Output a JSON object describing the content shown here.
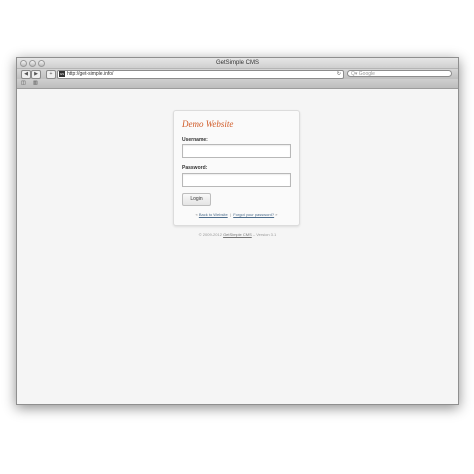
{
  "window": {
    "title": "GetSimple CMS"
  },
  "toolbar": {
    "back": "◀",
    "forward": "▶",
    "add": "+",
    "favicon": "GS",
    "url": "http://get-simple.info/",
    "reload": "↻",
    "search_placeholder": "Google",
    "search_icon": "Q▾"
  },
  "bookmarks": {
    "reading_list_icon": "◫",
    "bookmarks_icon": "▥"
  },
  "login": {
    "site_title": "Demo Website",
    "username_label": "Username:",
    "username_value": "",
    "password_label": "Password:",
    "password_value": "",
    "login_button": "Login",
    "separator_left": "«",
    "back_link": "Back to Website",
    "separator_mid": "|",
    "forgot_link": "Forgot your password?",
    "separator_right": "»"
  },
  "footer": {
    "prefix": "© 2009-2012",
    "link": "GetSimple CMS",
    "suffix": "– Version 3.1"
  }
}
